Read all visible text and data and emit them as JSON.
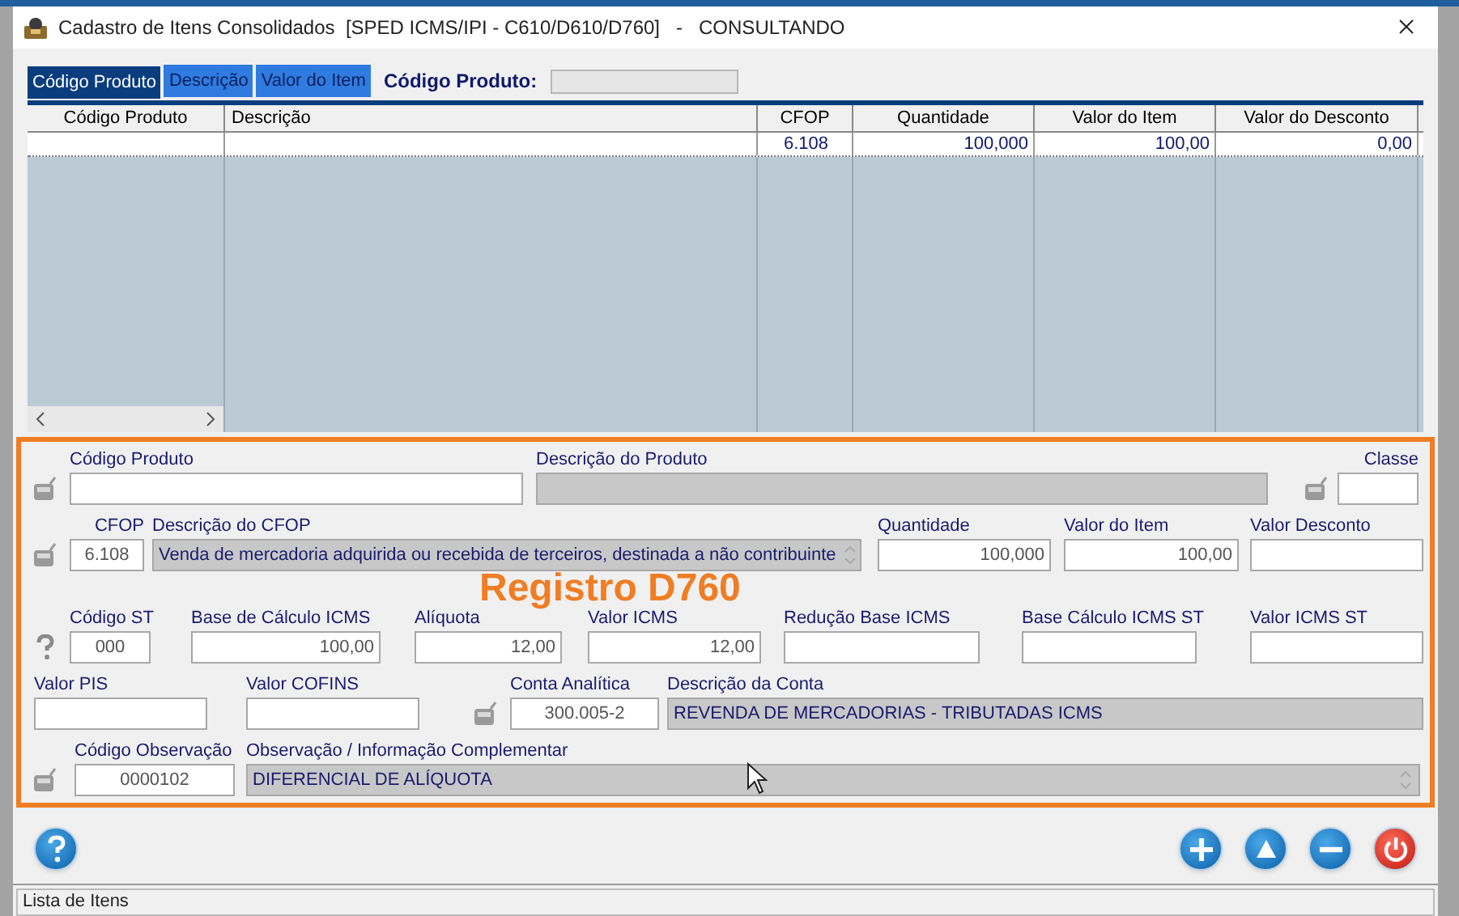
{
  "window": {
    "title": "Cadastro de Itens Consolidados  [SPED ICMS/IPI - C610/D610/D760]   -   CONSULTANDO"
  },
  "tabs": [
    {
      "label": "Código Produto",
      "selected": true
    },
    {
      "label": "Descrição",
      "selected": false
    },
    {
      "label": "Valor do Item",
      "selected": false
    }
  ],
  "search": {
    "label": "Código Produto:"
  },
  "table": {
    "columns": [
      "Código Produto",
      "Descrição",
      "CFOP",
      "Quantidade",
      "Valor do Item",
      "Valor do Desconto"
    ],
    "rows": [
      [
        "",
        "",
        "6.108",
        "100,000",
        "100,00",
        "0,00"
      ]
    ]
  },
  "form": {
    "lines": [
      {
        "items": [
          {
            "kind": "lookup"
          },
          {
            "kind": "field",
            "label": "Código Produto",
            "readonly": false
          },
          {
            "kind": "field",
            "label": "Descrição do Produto",
            "readonly": true
          },
          {
            "kind": "lookup"
          },
          {
            "kind": "field",
            "label": "Classe",
            "readonly": false
          }
        ]
      },
      {
        "items": [
          {
            "kind": "lookup"
          },
          {
            "kind": "field",
            "label": "CFOP",
            "value": "6.108",
            "readonly": false
          },
          {
            "kind": "scrollfield",
            "label": "Descrição do CFOP",
            "value": "Venda de mercadoria adquirida ou recebida de terceiros, destinada a não contribuinte",
            "readonly": true
          },
          {
            "kind": "field",
            "label": "Quantidade",
            "value": "100,000",
            "readonly": false
          },
          {
            "kind": "field",
            "label": "Valor do Item",
            "value": "100,00",
            "readonly": false
          },
          {
            "kind": "field",
            "label": "Valor Desconto",
            "readonly": false
          }
        ]
      },
      {
        "items": [
          {
            "kind": "help"
          },
          {
            "kind": "field",
            "label": "Código ST",
            "value": "000",
            "readonly": false
          },
          {
            "kind": "field",
            "label": "Base de Cálculo ICMS",
            "value": "100,00",
            "readonly": false
          },
          {
            "kind": "field",
            "label": "Alíquota",
            "value": "12,00",
            "readonly": false
          },
          {
            "kind": "field",
            "label": "Valor ICMS",
            "value": "12,00",
            "readonly": false
          },
          {
            "kind": "field",
            "label": "Redução Base ICMS",
            "readonly": false
          },
          {
            "kind": "field",
            "label": "Base Cálculo ICMS ST",
            "readonly": false
          },
          {
            "kind": "field",
            "label": "Valor ICMS ST",
            "readonly": false
          }
        ]
      },
      {
        "items": [
          {
            "kind": "field",
            "label": "Valor PIS",
            "readonly": false
          },
          {
            "kind": "field",
            "label": "Valor COFINS",
            "readonly": false
          },
          {
            "kind": "lookup"
          },
          {
            "kind": "field",
            "label": "Conta Analítica",
            "value": "300.005-2",
            "readonly": false
          },
          {
            "kind": "field",
            "label": "Descrição da Conta",
            "value": "REVENDA DE MERCADORIAS - TRIBUTADAS ICMS",
            "readonly": true
          }
        ]
      },
      {
        "items": [
          {
            "kind": "lookup"
          },
          {
            "kind": "field",
            "label": "Código Observação",
            "value": "0000102",
            "readonly": false
          },
          {
            "kind": "scrollfield",
            "label": "Observação / Informação Complementar",
            "value": "DIFERENCIAL DE ALÍQUOTA",
            "readonly": true
          }
        ]
      }
    ]
  },
  "annotation": "Registro D760",
  "buttons": [
    {
      "kind": "help"
    },
    {
      "kind": "add"
    },
    {
      "kind": "up"
    },
    {
      "kind": "remove"
    },
    {
      "kind": "power"
    }
  ],
  "status_bar": "Lista de Itens"
}
